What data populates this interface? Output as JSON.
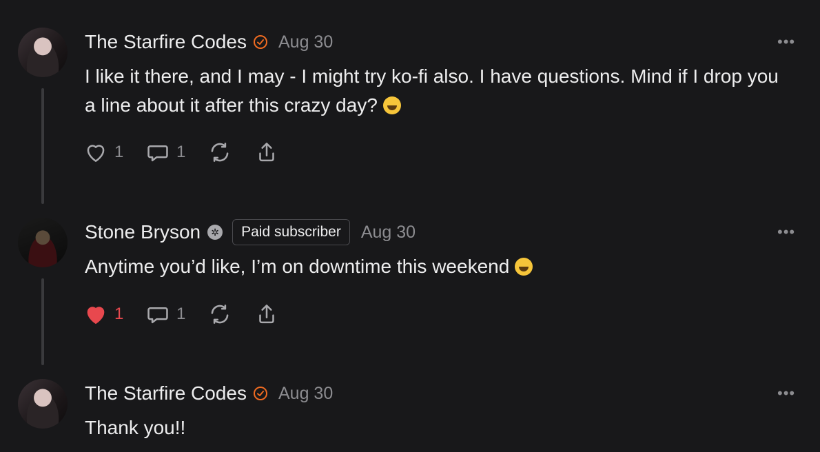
{
  "comments": [
    {
      "author": "The Starfire Codes",
      "date": "Aug 30",
      "text": "I like it there, and I may - I might try ko-fi also. I have questions. Mind if I drop you a line about it after this crazy day? ",
      "emoji_name": "rolling-on-floor-laughing-emoji",
      "likes": "1",
      "replies": "1",
      "liked": false,
      "more_label": "•••"
    },
    {
      "author": "Stone Bryson",
      "badge": "Paid subscriber",
      "date": "Aug 30",
      "text": "Anytime you’d like, I’m on downtime this weekend ",
      "emoji_name": "grinning-face-emoji",
      "likes": "1",
      "replies": "1",
      "liked": true,
      "more_label": "•••"
    },
    {
      "author": "The Starfire Codes",
      "date": "Aug 30",
      "text": "Thank you!!",
      "more_label": "•••"
    }
  ],
  "colors": {
    "background": "#18181a",
    "accent_orange": "#ef6b21",
    "liked_red": "#e8484e",
    "muted": "#8c8c90"
  },
  "icons": [
    "heart-icon",
    "comment-icon",
    "restack-icon",
    "share-icon",
    "verified-check-icon",
    "subscriber-icon",
    "more-icon"
  ]
}
